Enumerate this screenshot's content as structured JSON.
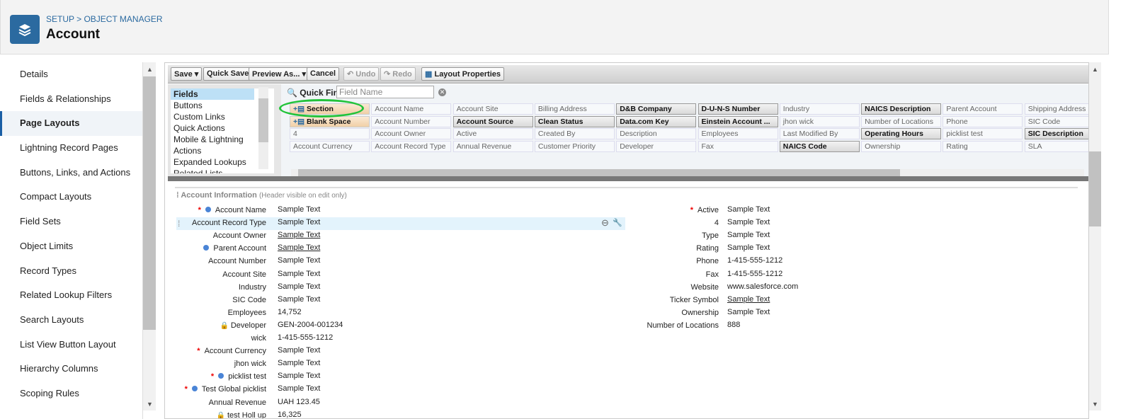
{
  "header": {
    "breadcrumb": "SETUP > OBJECT MANAGER",
    "title": "Account",
    "icon": "layers-icon"
  },
  "sidebar": {
    "items": [
      {
        "label": "Details"
      },
      {
        "label": "Fields & Relationships"
      },
      {
        "label": "Page Layouts",
        "active": true
      },
      {
        "label": "Lightning Record Pages"
      },
      {
        "label": "Buttons, Links, and Actions"
      },
      {
        "label": "Compact Layouts"
      },
      {
        "label": "Field Sets"
      },
      {
        "label": "Object Limits"
      },
      {
        "label": "Record Types"
      },
      {
        "label": "Related Lookup Filters"
      },
      {
        "label": "Search Layouts"
      },
      {
        "label": "List View Button Layout"
      },
      {
        "label": "Hierarchy Columns"
      },
      {
        "label": "Scoping Rules"
      }
    ]
  },
  "toolbar": {
    "save": "Save",
    "quick_save": "Quick Save",
    "preview": "Preview As...",
    "cancel": "Cancel",
    "undo": "Undo",
    "redo": "Redo",
    "layout_properties": "Layout Properties"
  },
  "palette": {
    "categories": [
      "Fields",
      "Buttons",
      "Custom Links",
      "Quick Actions",
      "Mobile & Lightning Actions",
      "Expanded Lookups",
      "Related Lists"
    ],
    "selected": "Fields",
    "quick_find_label": "Quick Find",
    "quick_find_placeholder": "Field Name",
    "grid": [
      [
        {
          "t": "Section",
          "k": "special"
        },
        {
          "t": "Account Name"
        },
        {
          "t": "Account Site"
        },
        {
          "t": "Billing Address"
        },
        {
          "t": "D&B Company",
          "k": "avail"
        },
        {
          "t": "D-U-N-S Number",
          "k": "avail"
        },
        {
          "t": "Industry"
        },
        {
          "t": "NAICS Description",
          "k": "avail"
        },
        {
          "t": "Parent Account"
        },
        {
          "t": "Shipping Address"
        }
      ],
      [
        {
          "t": "Blank Space",
          "k": "special"
        },
        {
          "t": "Account Number"
        },
        {
          "t": "Account Source",
          "k": "avail"
        },
        {
          "t": "Clean Status",
          "k": "avail"
        },
        {
          "t": "Data.com Key",
          "k": "avail"
        },
        {
          "t": "Einstein Account ...",
          "k": "avail"
        },
        {
          "t": "jhon wick"
        },
        {
          "t": "Number of Locations"
        },
        {
          "t": "Phone"
        },
        {
          "t": "SIC Code"
        }
      ],
      [
        {
          "t": "4"
        },
        {
          "t": "Account Owner"
        },
        {
          "t": "Active"
        },
        {
          "t": "Created By"
        },
        {
          "t": "Description"
        },
        {
          "t": "Employees"
        },
        {
          "t": "Last Modified By"
        },
        {
          "t": "Operating Hours",
          "k": "avail"
        },
        {
          "t": "picklist test"
        },
        {
          "t": "SIC Description",
          "k": "avail"
        }
      ],
      [
        {
          "t": "Account Currency"
        },
        {
          "t": "Account Record Type"
        },
        {
          "t": "Annual Revenue"
        },
        {
          "t": "Customer Priority"
        },
        {
          "t": "Developer"
        },
        {
          "t": "Fax"
        },
        {
          "t": "NAICS Code",
          "k": "avail"
        },
        {
          "t": "Ownership"
        },
        {
          "t": "Rating"
        },
        {
          "t": "SLA"
        }
      ]
    ]
  },
  "section": {
    "title": "Account Information",
    "note": "(Header visible on edit only)",
    "left": [
      {
        "label": "Account Name",
        "value": "Sample Text",
        "req": true,
        "dot": true
      },
      {
        "label": "Account Record Type",
        "value": "Sample Text",
        "hl": true
      },
      {
        "label": "Account Owner",
        "value": "Sample Text",
        "u": true
      },
      {
        "label": "Parent Account",
        "value": "Sample Text",
        "u": true,
        "dot": true
      },
      {
        "label": "Account Number",
        "value": "Sample Text"
      },
      {
        "label": "Account Site",
        "value": "Sample Text"
      },
      {
        "label": "Industry",
        "value": "Sample Text"
      },
      {
        "label": "SIC Code",
        "value": "Sample Text"
      },
      {
        "label": "Employees",
        "value": "14,752"
      },
      {
        "label": "Developer",
        "value": "GEN-2004-001234",
        "lock": true
      },
      {
        "label": "wick",
        "value": "1-415-555-1212"
      },
      {
        "label": "Account Currency",
        "value": "Sample Text",
        "req": true
      },
      {
        "label": "jhon wick",
        "value": "Sample Text"
      },
      {
        "label": "picklist test",
        "value": "Sample Text",
        "req": true,
        "dot": true
      },
      {
        "label": "Test Global picklist",
        "value": "Sample Text",
        "req": true,
        "dot": true
      },
      {
        "label": "Annual Revenue",
        "value": "UAH 123.45"
      },
      {
        "label": "test Holl up",
        "value": "16,325",
        "lock": true
      }
    ],
    "right": [
      {
        "label": "Active",
        "value": "Sample Text",
        "req": true
      },
      {
        "label": "4",
        "value": "Sample Text"
      },
      {
        "label": "Type",
        "value": "Sample Text"
      },
      {
        "label": "Rating",
        "value": "Sample Text"
      },
      {
        "label": "Phone",
        "value": "1-415-555-1212"
      },
      {
        "label": "Fax",
        "value": "1-415-555-1212"
      },
      {
        "label": "Website",
        "value": "www.salesforce.com"
      },
      {
        "label": "Ticker Symbol",
        "value": "Sample Text",
        "u": true
      },
      {
        "label": "Ownership",
        "value": "Sample Text"
      },
      {
        "label": "Number of Locations",
        "value": "888"
      }
    ]
  },
  "colors": {
    "accent": "#2b6aa0",
    "highlight": "#e3f3fc",
    "required": "#e00000",
    "ring": "#22c33a"
  }
}
